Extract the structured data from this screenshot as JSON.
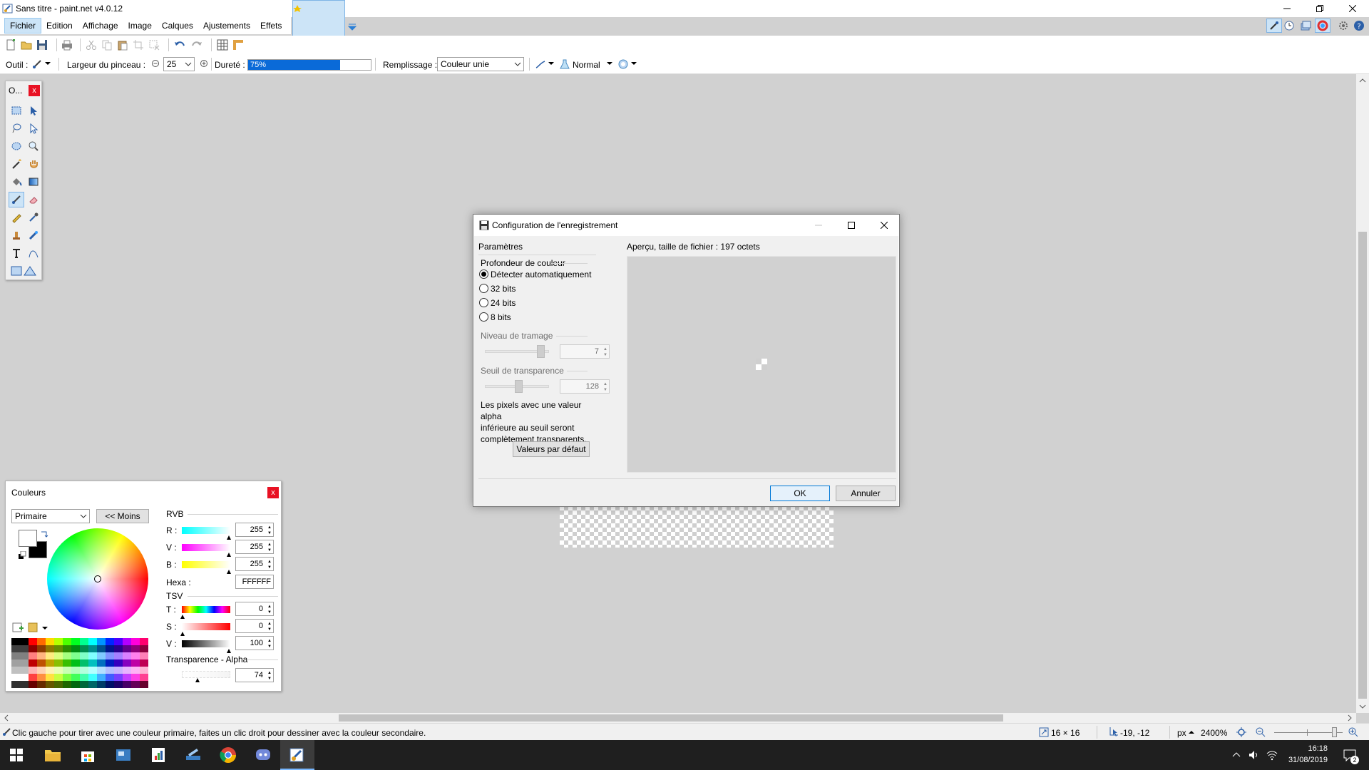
{
  "window": {
    "title": "Sans titre - paint.net v4.0.12"
  },
  "menu": {
    "items": [
      "Fichier",
      "Edition",
      "Affichage",
      "Image",
      "Calques",
      "Ajustements",
      "Effets"
    ]
  },
  "toolbar": {
    "tool_label": "Outil :",
    "brush_width_label": "Largeur du pinceau :",
    "brush_width_value": "25",
    "hardness_label": "Dureté :",
    "hardness_text": "75%",
    "hardness_percent": 75,
    "fill_label": "Remplissage :",
    "fill_value": "Couleur unie",
    "blend_mode": "Normal"
  },
  "tools_panel": {
    "title": "O..."
  },
  "colors_panel": {
    "title": "Couleurs",
    "mode_value": "Primaire",
    "less_button": "<< Moins",
    "rgb_title": "RVB",
    "r_label": "R :",
    "r_value": "255",
    "g_label": "V :",
    "g_value": "255",
    "b_label": "B :",
    "b_value": "255",
    "hex_label": "Hexa :",
    "hex_value": "FFFFFF",
    "hsv_title": "TSV",
    "h_label": "T :",
    "h_value": "0",
    "s_label": "S :",
    "s_value": "0",
    "v_label": "V :",
    "v_value": "100",
    "alpha_title": "Transparence - Alpha",
    "alpha_value": "74",
    "primary_color": "#ffffff",
    "secondary_color": "#000000"
  },
  "dialog": {
    "title": "Configuration de l'enregistrement",
    "params_label": "Paramètres",
    "depth_label": "Profondeur de couleur",
    "options": [
      "Détecter automatiquement",
      "32 bits",
      "24 bits",
      "8 bits"
    ],
    "selected_option": 0,
    "dither_label": "Niveau de tramage",
    "dither_value": "7",
    "threshold_label": "Seuil de transparence",
    "threshold_value": "128",
    "help_text_lines": [
      "Les pixels avec une valeur alpha",
      "inférieure au seuil seront",
      "complètement transparents."
    ],
    "defaults_button": "Valeurs par défaut",
    "preview_label": "Aperçu, taille de fichier : 197 octets",
    "ok_button": "OK",
    "cancel_button": "Annuler"
  },
  "status": {
    "hint": "Clic gauche pour tirer avec une couleur primaire, faites un clic droit pour dessiner avec la couleur secondaire.",
    "image_size": "16 × 16",
    "cursor_pos": "-19, -12",
    "units": "px",
    "zoom": "2400%"
  },
  "taskbar": {
    "time": "16:18",
    "date": "31/08/2019",
    "notifications": "2"
  },
  "colors": {
    "accent": "#0a6ad8",
    "selection": "#cce4f7",
    "close_red": "#e81123"
  }
}
